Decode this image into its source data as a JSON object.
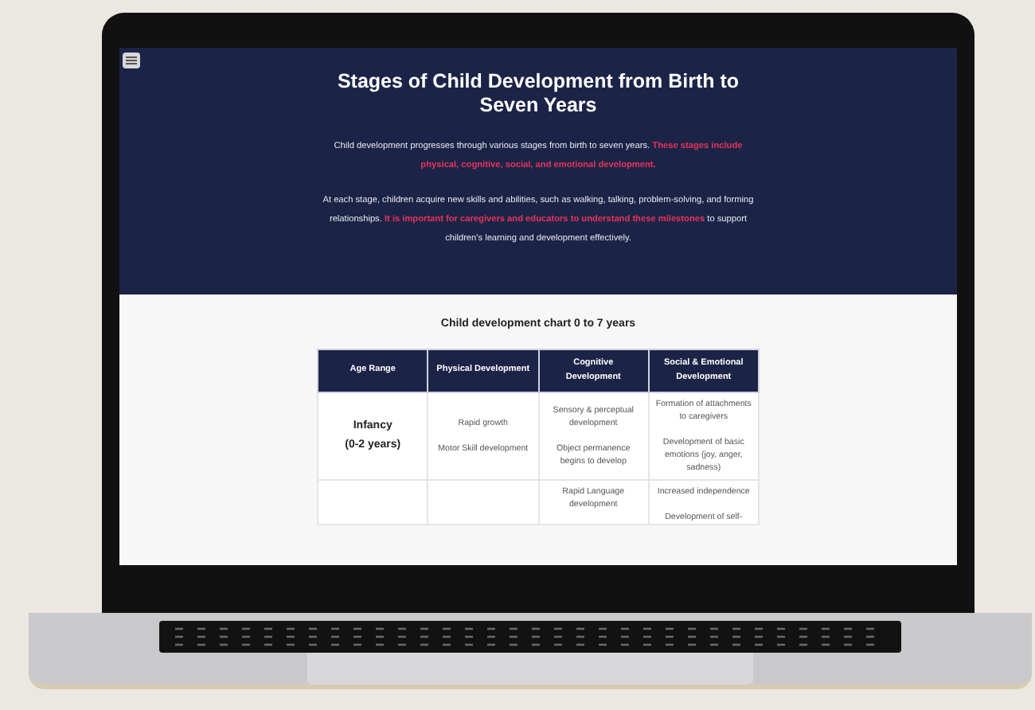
{
  "page": {
    "title": "Stages of Child Development from Birth to Seven Years",
    "paragraphs": [
      "Child development progresses through various stages from birth to seven years. **These stages include physical, cognitive, social, and emotional development.**",
      "At each stage, children acquire new skills and abilities, such as walking, talking, problem-solving, and forming relationships. **It is important for caregivers and educators to understand these milestones** to support children's learning and development effectively."
    ]
  },
  "table": {
    "caption": "Child development chart 0 to 7 years",
    "columns": [
      "Age Range",
      "Physical Development",
      "Cognitive Development",
      "Social & Emotional Development"
    ],
    "rows": [
      {
        "cells": [
          {
            "lines": [
              "Infancy",
              "(0-2 years)"
            ],
            "kind": "heading"
          },
          {
            "lines": [
              "Rapid growth",
              "Motor Skill development"
            ]
          },
          {
            "lines": [
              "Sensory & perceptual development",
              "Object permanence begins to develop"
            ]
          },
          {
            "lines": [
              "Formation of attachments to caregivers",
              "Development of basic emotions (joy, anger, sadness)"
            ]
          }
        ]
      },
      {
        "cells": [
          {},
          {},
          {
            "lines": [
              "Rapid Language development"
            ]
          },
          {
            "lines": [
              "Increased independence",
              "Development of self-"
            ]
          }
        ]
      }
    ]
  }
}
